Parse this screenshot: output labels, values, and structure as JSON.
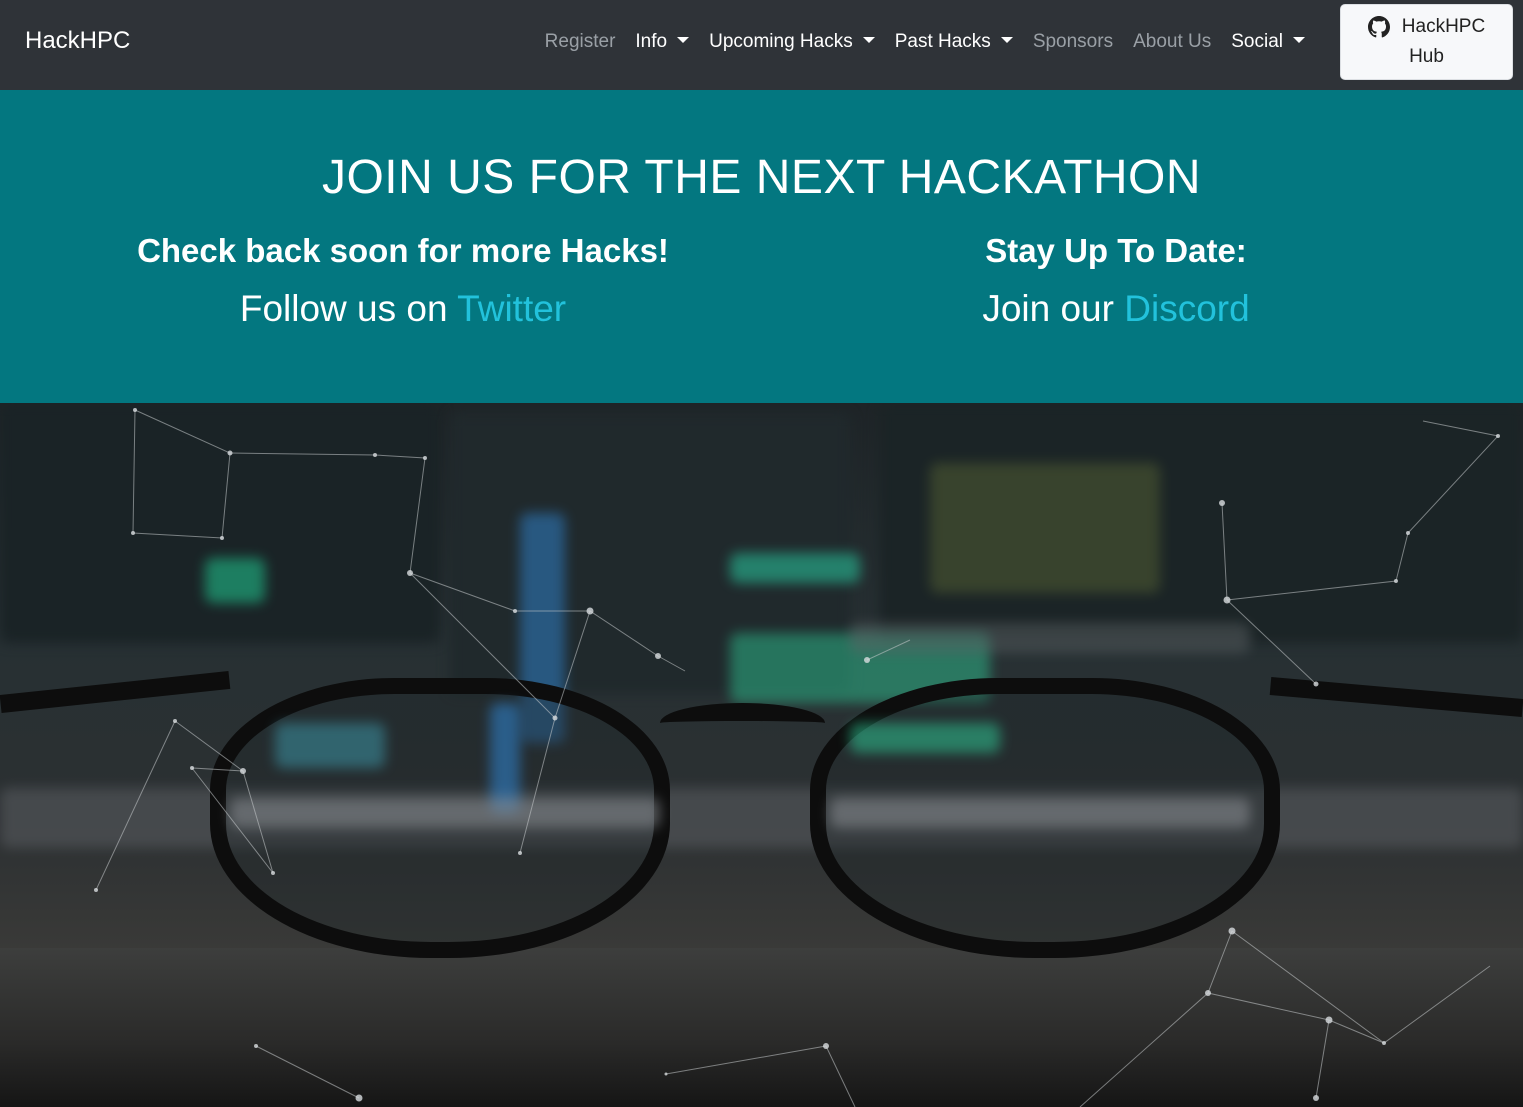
{
  "navbar": {
    "brand": "HackHPC",
    "items": [
      {
        "label": "Register",
        "style": "muted",
        "dropdown": false
      },
      {
        "label": "Info",
        "style": "bright",
        "dropdown": true
      },
      {
        "label": "Upcoming Hacks",
        "style": "bright",
        "dropdown": true
      },
      {
        "label": "Past Hacks",
        "style": "bright",
        "dropdown": true
      },
      {
        "label": "Sponsors",
        "style": "muted",
        "dropdown": false
      },
      {
        "label": "About Us",
        "style": "muted",
        "dropdown": false
      },
      {
        "label": "Social",
        "style": "bright",
        "dropdown": true
      }
    ],
    "hub_button": {
      "line1": "HackHPC",
      "line2": "Hub",
      "icon": "github-icon"
    }
  },
  "hero": {
    "title": "JOIN US FOR THE NEXT HACKATHON",
    "left": {
      "heading": "Check back soon for more Hacks!",
      "prefix": "Follow us on ",
      "link": "Twitter"
    },
    "right": {
      "heading": "Stay Up To Date:",
      "prefix": "Join our ",
      "link": "Discord"
    }
  },
  "colors": {
    "navbar_bg": "#2f3338",
    "hero_bg": "#037780",
    "link_accent": "#22c2dc"
  },
  "background_image": {
    "subject": "eyeglasses in front of computer monitors with code, particle network overlay"
  }
}
